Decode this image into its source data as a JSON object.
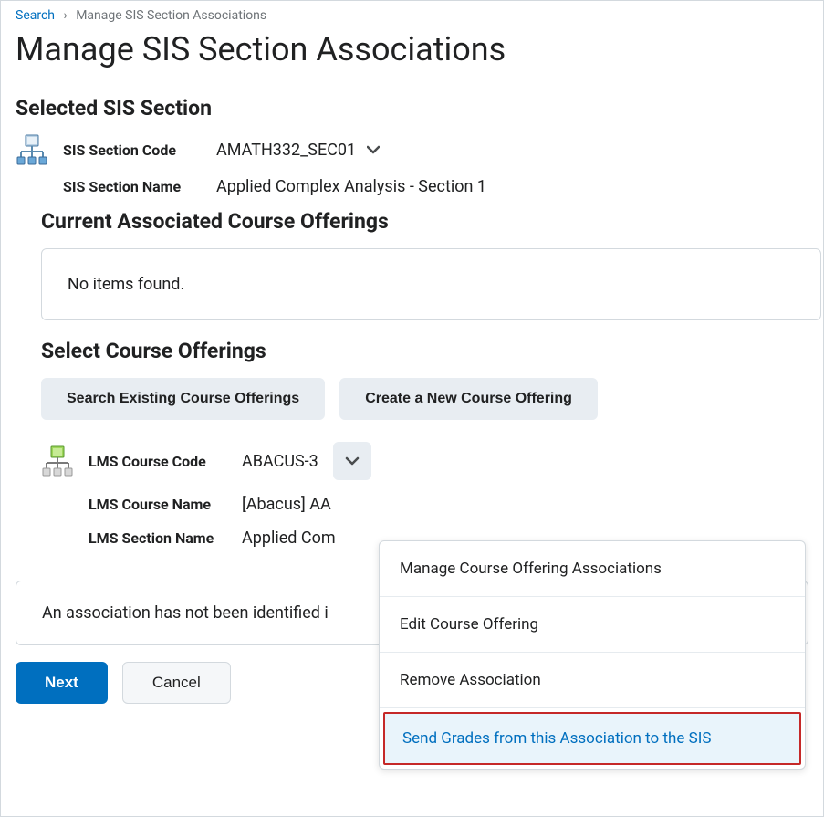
{
  "breadcrumb": {
    "link": "Search",
    "current": "Manage SIS Section Associations"
  },
  "page_title": "Manage SIS Section Associations",
  "selected_sis": {
    "heading": "Selected SIS Section",
    "code_label": "SIS Section Code",
    "code_value": "AMATH332_SEC01",
    "name_label": "SIS Section Name",
    "name_value": "Applied Complex Analysis - Section 1"
  },
  "current_offerings": {
    "heading": "Current Associated Course Offerings",
    "empty_message": "No items found."
  },
  "select_offerings": {
    "heading": "Select Course Offerings",
    "search_button": "Search Existing Course Offerings",
    "create_button": "Create a New Course Offering"
  },
  "lms": {
    "code_label": "LMS Course Code",
    "code_value": "ABACUS-3",
    "name_label": "LMS Course Name",
    "name_value": "[Abacus] AA",
    "section_label": "LMS Section Name",
    "section_value": "Applied Com"
  },
  "dropdown": {
    "item1": "Manage Course Offering Associations",
    "item2": "Edit Course Offering",
    "item3": "Remove Association",
    "item4": "Send Grades from this Association to the SIS"
  },
  "info_message": "An association has not been identified i",
  "footer": {
    "next": "Next",
    "cancel": "Cancel"
  }
}
